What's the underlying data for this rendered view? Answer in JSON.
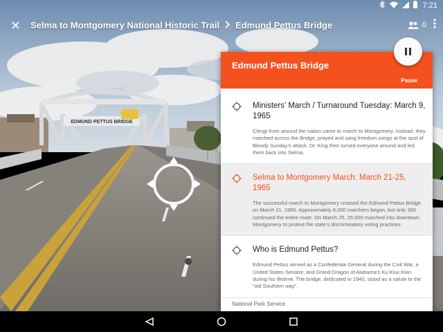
{
  "status_bar": {
    "time": "7:21",
    "icons": [
      "bluetooth-icon",
      "wifi-icon",
      "signal-icon",
      "battery-icon"
    ]
  },
  "app_bar": {
    "breadcrumb": [
      "Selma to Montgomery National Historic Trail",
      "Edmund Pettus Bridge"
    ],
    "viewer_count": "0",
    "icons": [
      "close-icon",
      "people-icon",
      "more-vert-icon"
    ]
  },
  "scene": {
    "bridge_sign": "EDMUND PETTUS BRIDGE",
    "sky_color": "#a9bcd0",
    "road_color": "#8a8680"
  },
  "panel": {
    "title": "Edmund Pettus Bridge",
    "pause_label": "Pause",
    "accent": "#f4511e",
    "items": [
      {
        "title": "Ministers’ March / Turnaround Tuesday: March 9, 1965",
        "body": "Clergy from around the nation came to march to Montgomery. Instead, they marched across the Bridge, prayed and sang freedom songs at the spot of Bloody Sunday’s attack. Dr. King then turned everyone around and led them back into Selma.",
        "active": false
      },
      {
        "title": "Selma to Montgomery March: March 21-25, 1965",
        "body": "The successful march to Montgomery crossed the Edmund Pettus Bridge on March 21, 1965. Approximately 6,000 marchers began, but only 300 continued the entire route. On March 25, 25,000 marched into downtown Montgomery to protest the state’s discriminatory voting practices.",
        "active": true
      },
      {
        "title": "Who is Edmund Pettus?",
        "body": "Edmund Pettus served as a Confederate General during the Civil War, a United States Senator, and Grand Dragon of Alabama’s Ku Klux Klan during his lifetime. The bridge, dedicated in 1940, stood as a salute to the “old Southern way”.",
        "active": false
      }
    ],
    "footer": "National Park Service"
  },
  "nav_bar": {
    "icons": [
      "back-icon",
      "home-icon",
      "recents-icon"
    ]
  }
}
